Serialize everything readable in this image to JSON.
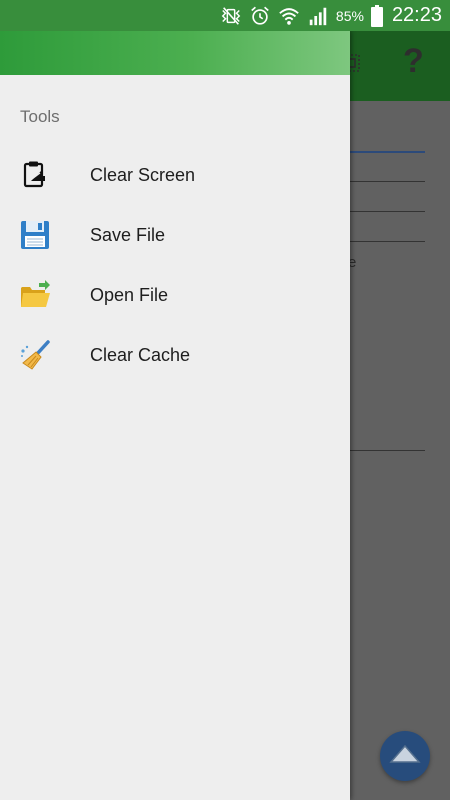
{
  "status_bar": {
    "battery_percent": "85%",
    "time": "22:23",
    "icons": [
      "mute-vibrate-icon",
      "alarm-icon",
      "wifi-icon",
      "signal-icon",
      "battery-icon"
    ]
  },
  "drawer": {
    "section_title": "Tools",
    "items": [
      {
        "label": "Clear Screen",
        "icon": "clear-screen-icon"
      },
      {
        "label": "Save File",
        "icon": "floppy-disk-icon"
      },
      {
        "label": "Open File",
        "icon": "open-folder-icon"
      },
      {
        "label": "Clear Cache",
        "icon": "broom-icon"
      }
    ]
  },
  "background_app": {
    "toolbar_icons": [
      "menu-grid-icon",
      "help-icon"
    ],
    "help_glyph": "?",
    "partial_text": "e",
    "fab_icon": "chevron-up-icon"
  },
  "colors": {
    "status_bar": "#388e3c",
    "app_bar_dimmed": "#1b5e20",
    "drawer_bg": "#eeeeee",
    "fab": "#274c7c"
  }
}
